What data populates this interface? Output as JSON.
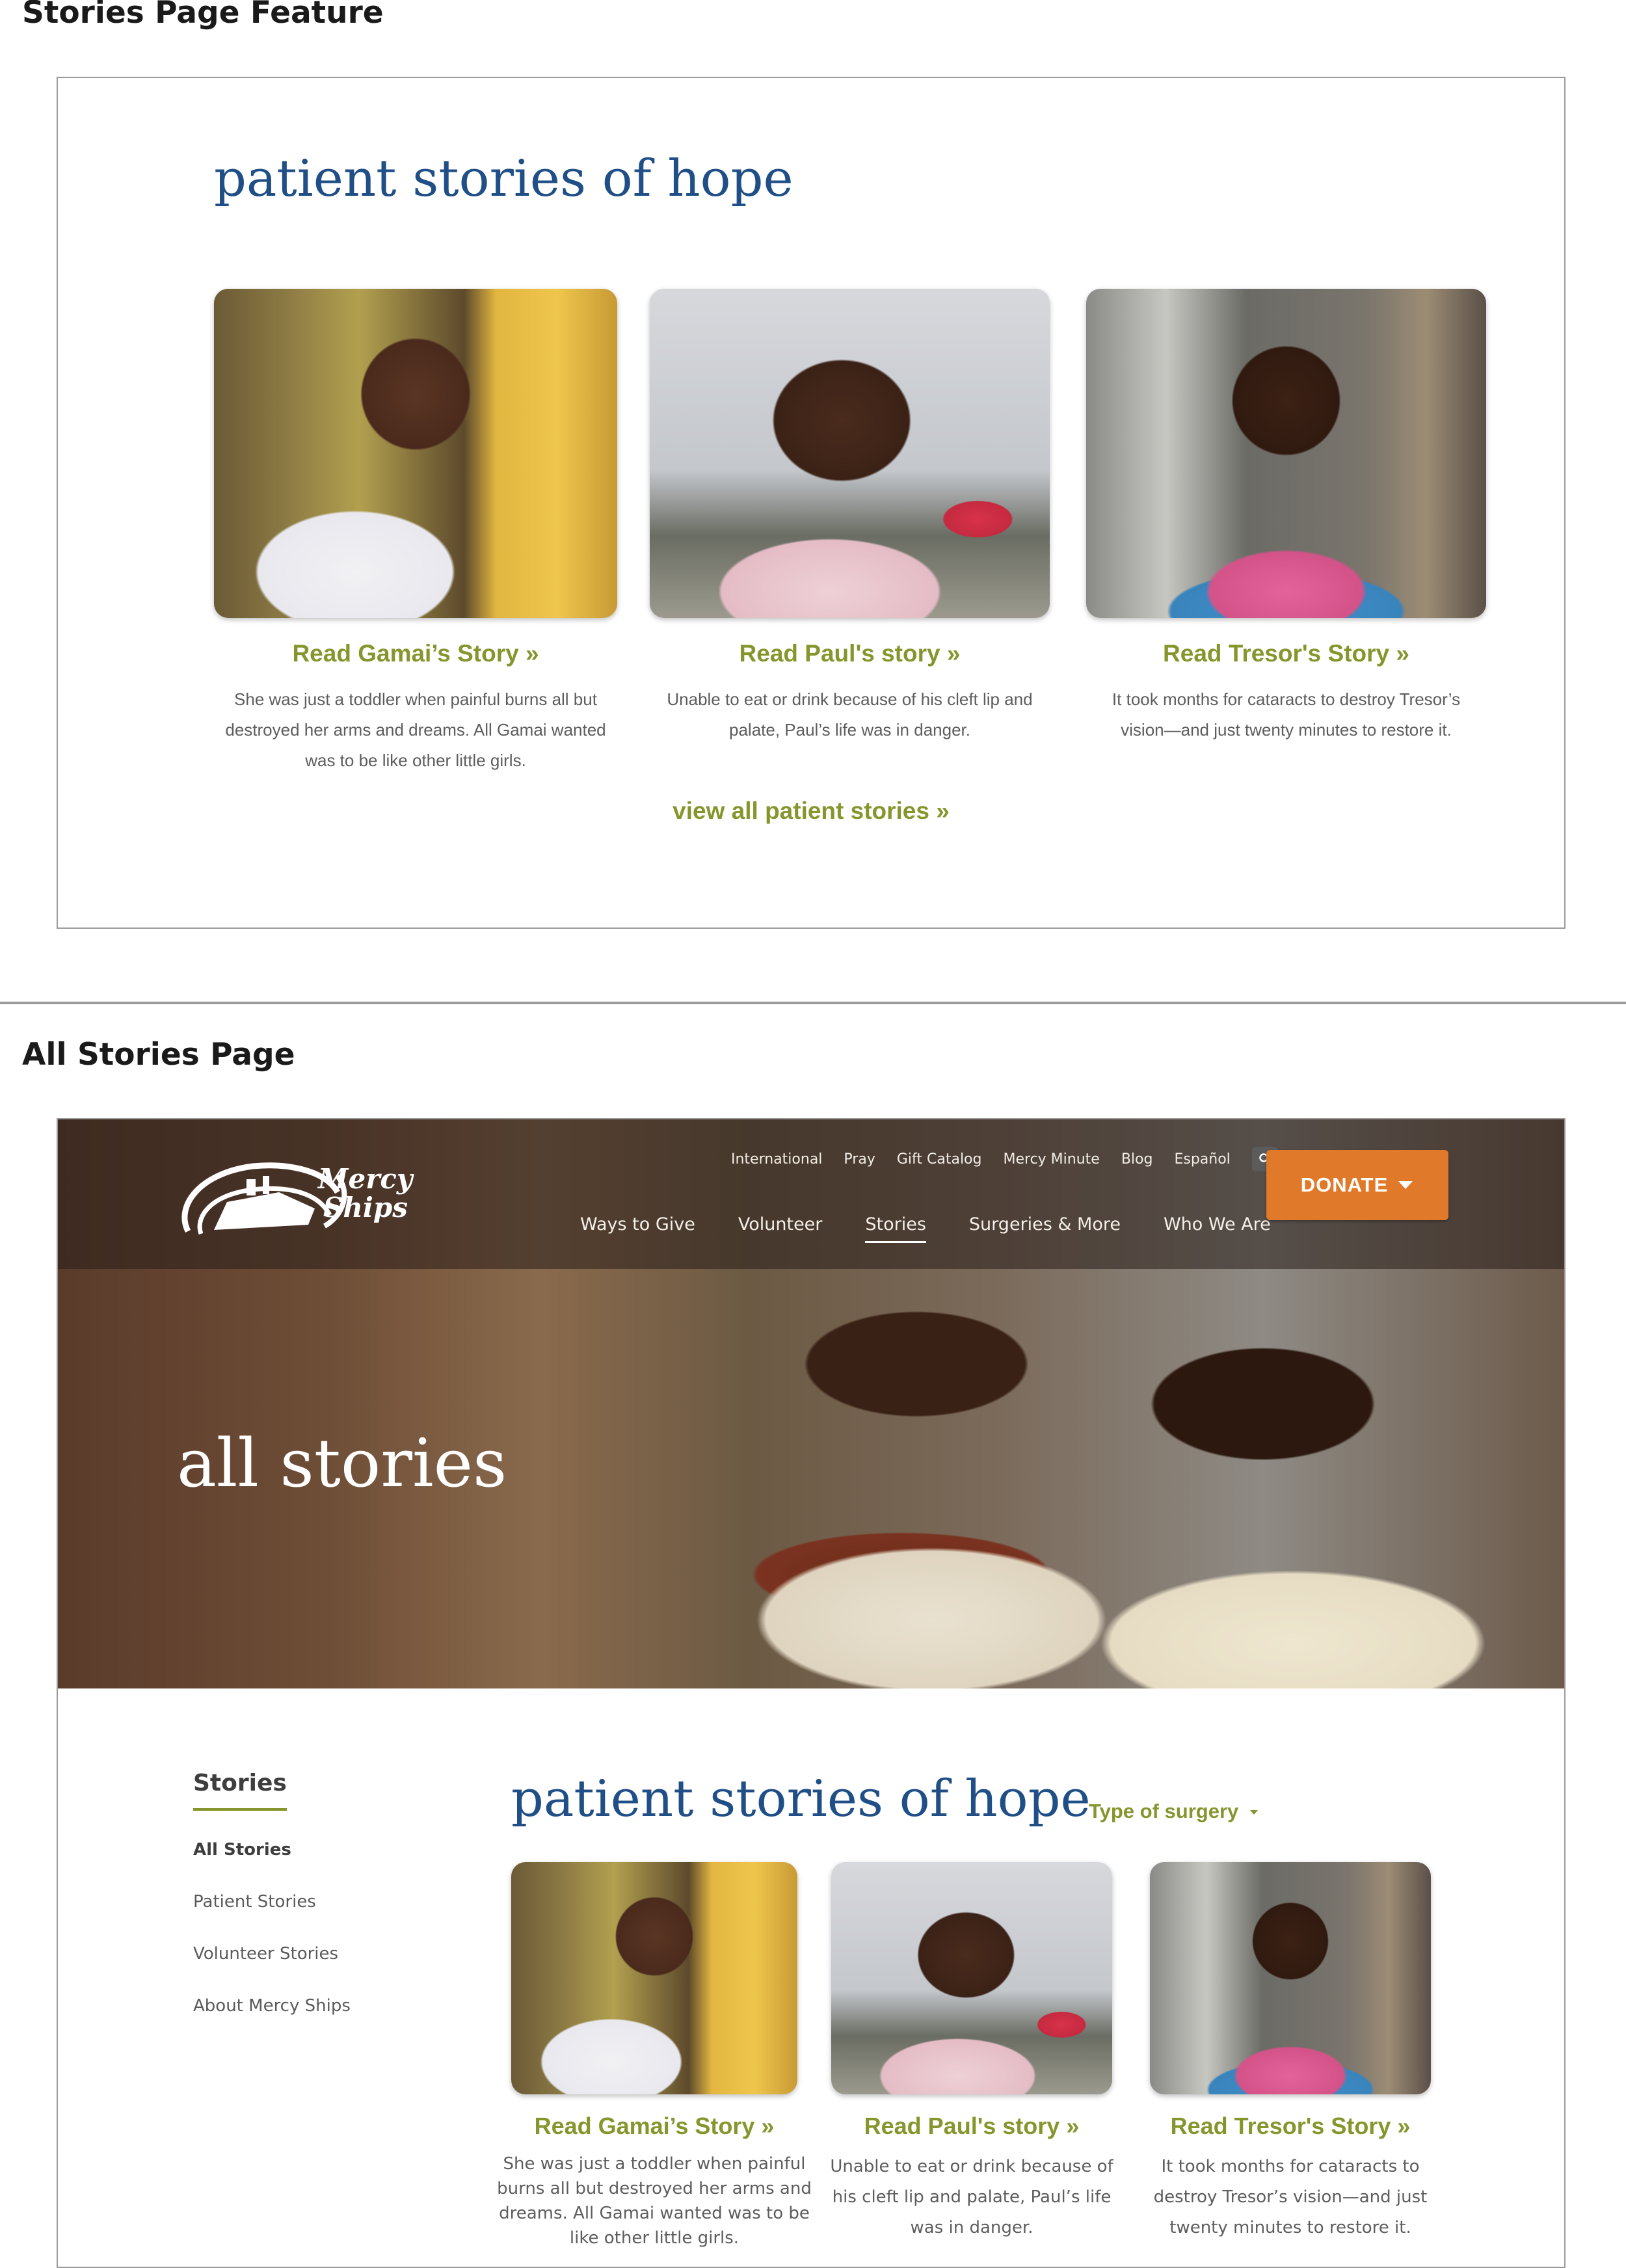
{
  "section1": {
    "heading": "Stories Page Feature"
  },
  "section2": {
    "heading": "All Stories Page"
  },
  "feature": {
    "title": "patient stories of hope",
    "cards": [
      {
        "photo": "gamai-photo",
        "link": "Read Gamai’s Story »",
        "desc": "She was just a toddler when painful burns all but destroyed her arms and dreams. All Gamai wanted was to be like other little girls."
      },
      {
        "photo": "paul-photo",
        "link": "Read Paul's story »",
        "desc": "Unable to eat or drink because of his cleft lip and palate, Paul’s life was in danger."
      },
      {
        "photo": "tresor-photo",
        "link": "Read Tresor's Story »",
        "desc": "It took months for cataracts to destroy Tresor’s vision—and just twenty minutes to restore it."
      }
    ],
    "view_all": "view all patient stories  »"
  },
  "site": {
    "logo_line1": "Mercy",
    "logo_line2": "Ships",
    "util_nav": [
      "International",
      "Pray",
      "Gift Catalog",
      "Mercy Minute",
      "Blog",
      "Español"
    ],
    "search_icon": "search-icon",
    "main_nav": [
      "Ways to Give",
      "Volunteer",
      "Stories",
      "Surgeries & More",
      "Who We Are"
    ],
    "active_nav": "Stories",
    "donate": "DONATE",
    "hero_title": "all stories",
    "sidebar": {
      "heading": "Stories",
      "items": [
        "All Stories",
        "Patient Stories",
        "Volunteer Stories",
        "About Mercy Ships"
      ],
      "current": "All Stories"
    },
    "title": "patient stories of hope",
    "filter": "Type of surgery",
    "cards": [
      {
        "link": "Read Gamai’s Story »",
        "desc": "She was just a toddler when painful burns all but destroyed her arms and dreams. All Gamai wanted was to be like other little girls."
      },
      {
        "link": "Read Paul's story »",
        "desc": "Unable to eat or drink because of his cleft lip and palate, Paul’s life was in danger."
      },
      {
        "link": "Read Tresor's Story »",
        "desc": "It took months for cataracts to destroy Tresor’s vision—and just twenty minutes to restore it."
      }
    ]
  },
  "colors": {
    "accent_green": "#86962d",
    "title_blue": "#1f4f86",
    "donate_orange": "#e07a2a"
  }
}
